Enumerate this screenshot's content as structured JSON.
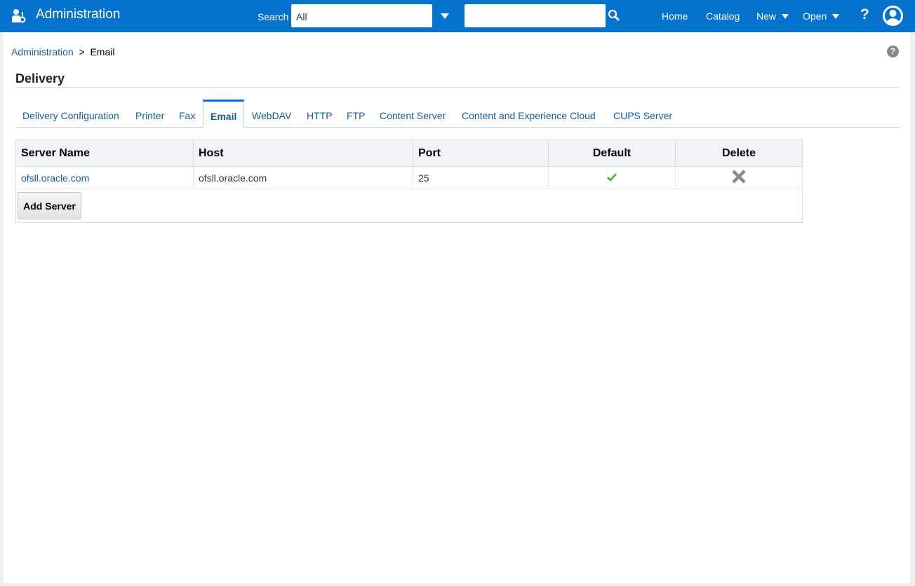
{
  "header": {
    "app_title": "Administration",
    "search_label": "Search",
    "search_scope": "All",
    "search_value": "",
    "nav": {
      "home": "Home",
      "catalog": "Catalog",
      "new": "New",
      "open": "Open",
      "help": "?"
    }
  },
  "breadcrumb": {
    "parent": "Administration",
    "separator": ">",
    "current": "Email"
  },
  "page_help": "?",
  "section_title": "Delivery",
  "tabs": [
    {
      "label": "Delivery Configuration"
    },
    {
      "label": "Printer"
    },
    {
      "label": "Fax"
    },
    {
      "label": "Email"
    },
    {
      "label": "WebDAV"
    },
    {
      "label": "HTTP"
    },
    {
      "label": "FTP"
    },
    {
      "label": "Content Server"
    },
    {
      "label": "Content and Experience Cloud"
    },
    {
      "label": "CUPS Server"
    }
  ],
  "active_tab": "Email",
  "table": {
    "columns": [
      "Server Name",
      "Host",
      "Port",
      "Default",
      "Delete"
    ],
    "rows": [
      {
        "server_name": "ofsll.oracle.com",
        "host": "ofsll.oracle.com",
        "port": "25",
        "default": true
      }
    ]
  },
  "add_server_label": "Add Server",
  "colors": {
    "brand": "#0572ce",
    "link": "#145c9e",
    "check": "#4caf22"
  }
}
